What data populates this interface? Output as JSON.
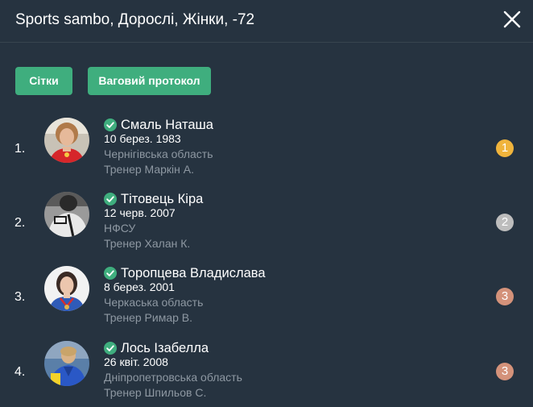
{
  "header": {
    "title": "Sports sambo, Дорослі, Жінки, -72",
    "close_icon": "close-icon"
  },
  "buttons": {
    "grids_label": "Сітки",
    "weight_protocol_label": "Ваговий протокол"
  },
  "results": [
    {
      "place": "1.",
      "name": "Смаль Наташа",
      "dob": "10 берез. 1983",
      "region": "Чернігівська область",
      "coach": "Тренер Маркін А.",
      "medal": "1",
      "medal_color": "#f0b43c",
      "verified_icon": "check-circle-icon"
    },
    {
      "place": "2.",
      "name": "Тітовець Кіра",
      "dob": "12 черв. 2007",
      "region": "НФСУ",
      "coach": "Тренер Халан К.",
      "medal": "2",
      "medal_color": "#bdbdbd",
      "verified_icon": "check-circle-icon"
    },
    {
      "place": "3.",
      "name": "Торопцева Владислава",
      "dob": "8 берез. 2001",
      "region": "Черкаська область",
      "coach": "Тренер Римар В.",
      "medal": "3",
      "medal_color": "#d4927a",
      "verified_icon": "check-circle-icon"
    },
    {
      "place": "4.",
      "name": "Лось Ізабелла",
      "dob": "26 квіт. 2008",
      "region": "Дніпропетровська область",
      "coach": "Тренер Шпильов С.",
      "medal": "3",
      "medal_color": "#d4927a",
      "verified_icon": "check-circle-icon"
    }
  ],
  "colors": {
    "background": "#263340",
    "accent_button": "#3fae7e",
    "verified": "#3fae7e",
    "secondary_text": "#8e98a2"
  }
}
